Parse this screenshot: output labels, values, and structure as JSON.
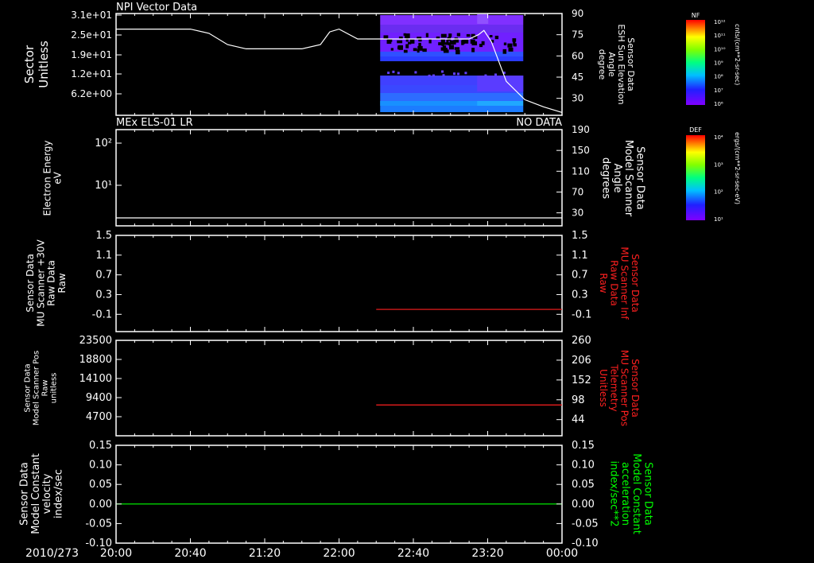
{
  "colors": {
    "background": "#000000",
    "axis": "#ffffff",
    "red_trace": "#ff2020",
    "green_trace": "#00ff00",
    "spectrogram_blue": "#4040ff",
    "spectrogram_purple": "#8020ff"
  },
  "time_axis": {
    "date": "2010/273",
    "ticks": [
      "20:00",
      "20:40",
      "21:20",
      "22:00",
      "22:40",
      "23:20",
      "00:00"
    ]
  },
  "colorbars": [
    {
      "title": "NF",
      "top_label": "10¹²",
      "labels": [
        "10¹²",
        "10¹¹",
        "10¹⁰",
        "10⁹",
        "10⁸",
        "10⁷",
        "10⁶"
      ],
      "units": "cnts/(cm**2-sr-sec)"
    },
    {
      "title": "DEF",
      "top_label": "10⁴",
      "labels": [
        "10⁴",
        "10³",
        "10²",
        "10¹"
      ],
      "units": "ergs/(cm**2-sr-sec-eV)"
    }
  ],
  "chart_data": [
    {
      "type": "heatmap",
      "title": "NPI Vector Data",
      "ylabel": "Sector\nUnitless",
      "yticks": [
        "3.1e+01",
        "2.5e+01",
        "1.9e+01",
        "1.2e+01",
        "6.2e+00"
      ],
      "right_ylabel": "Sensor Data\nESH Sun Elevation\nAngle\ndegree",
      "right_yticks": [
        "90",
        "75",
        "60",
        "45",
        "30"
      ],
      "right_ylim": [
        18,
        90
      ],
      "data_span": [
        "22:20",
        "23:40"
      ],
      "line_series": {
        "name": "Sensor Data ESH Sun Elevation Angle",
        "x": [
          "20:00",
          "20:40",
          "20:50",
          "21:00",
          "21:10",
          "21:20",
          "21:40",
          "21:50",
          "21:55",
          "22:00",
          "22:10",
          "22:20",
          "22:40",
          "23:00",
          "23:10",
          "23:15",
          "23:18",
          "23:22",
          "23:30",
          "23:40",
          "23:50",
          "24:00"
        ],
        "y": [
          79,
          79,
          76,
          68,
          65,
          65,
          65,
          68,
          77,
          79,
          72,
          72,
          72,
          72,
          72,
          75,
          78,
          70,
          42,
          29,
          24,
          20
        ]
      }
    },
    {
      "type": "line",
      "title": "MEx ELS-01 LR",
      "status": "NO DATA",
      "ylabel": "Electron Energy\neV",
      "yticks": [
        "10²",
        "10¹"
      ],
      "right_ylabel": "Sensor Data\nModel Scanner\nAngle\ndegrees",
      "right_yticks": [
        "190",
        "150",
        "110",
        "70",
        "30"
      ],
      "right_ylim": [
        5,
        190
      ],
      "series": [
        {
          "x": [
            "20:00",
            "24:00"
          ],
          "values": [
            10,
            10
          ]
        }
      ]
    },
    {
      "type": "line",
      "ylabel": "Sensor Data\nMU Scanner +30V\nRaw Data\nRaw",
      "yticks": [
        "1.5",
        "1.1",
        "0.7",
        "0.3",
        "-0.1"
      ],
      "ylim": [
        -0.45,
        1.5
      ],
      "right_ylabel": "Sensor Data\nMU Scanner Inf\nRaw Data\nRaw",
      "right_yticks": [
        "1.5",
        "1.1",
        "0.7",
        "0.3",
        "-0.1"
      ],
      "series": [
        {
          "x": [
            "22:20",
            "24:00"
          ],
          "values": [
            0.0,
            0.0
          ]
        }
      ]
    },
    {
      "type": "line",
      "ylabel": "Sensor Data\nModel Scanner Pos\nRaw\nunitless",
      "yticks": [
        "23500",
        "18800",
        "14100",
        "9400",
        "4700"
      ],
      "ylim": [
        0,
        23500
      ],
      "right_ylabel": "Sensor Data\nMU Scanner Pos\nTelemetry\nUnitless",
      "right_yticks": [
        "260",
        "206",
        "152",
        "98",
        "44"
      ],
      "right_ylim": [
        0,
        260
      ],
      "series": [
        {
          "x": [
            "22:20",
            "24:00"
          ],
          "values": [
            84,
            84
          ]
        }
      ]
    },
    {
      "type": "line",
      "ylabel": "Sensor Data\nModel Constant\nvelocity\nindex/sec",
      "yticks": [
        "0.15",
        "0.10",
        "0.05",
        "0.00",
        "-0.05",
        "-0.10"
      ],
      "ylim": [
        -0.1,
        0.15
      ],
      "right_ylabel": "Sensor Data\nModel Constant\nacceleration\nindex/sec**2",
      "right_yticks": [
        "0.15",
        "0.10",
        "0.05",
        "0.00",
        "-0.05",
        "-0.10"
      ],
      "series": [
        {
          "x": [
            "20:00",
            "24:00"
          ],
          "values": [
            0.0,
            0.0
          ]
        }
      ]
    }
  ]
}
